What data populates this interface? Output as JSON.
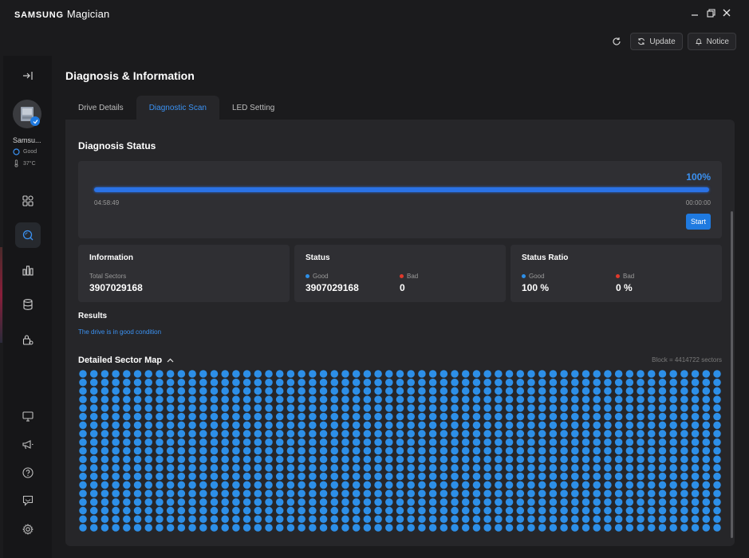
{
  "app": {
    "brand_main": "SAMSUNG",
    "brand_sub": "Magician"
  },
  "window_controls": [
    "minimize-icon",
    "restore-icon",
    "close-icon"
  ],
  "top_actions": {
    "refresh_icon": "refresh-icon",
    "update_label": "Update",
    "notice_label": "Notice"
  },
  "sidebar": {
    "drive": {
      "name": "Samsu...",
      "health": "Good",
      "temperature": "37°C"
    },
    "items": [
      {
        "name": "collapse",
        "icon": "collapse-arrow-icon"
      },
      {
        "name": "overview",
        "icon": "grid-icon"
      },
      {
        "name": "diagnosis",
        "icon": "search-icon",
        "active": true
      },
      {
        "name": "benchmark",
        "icon": "bar-chart-icon"
      },
      {
        "name": "data-management",
        "icon": "database-icon"
      },
      {
        "name": "security",
        "icon": "lock-icon"
      },
      {
        "name": "display",
        "icon": "monitor-icon"
      },
      {
        "name": "announcements",
        "icon": "megaphone-icon"
      },
      {
        "name": "help",
        "icon": "help-icon"
      },
      {
        "name": "feedback",
        "icon": "chat-icon"
      },
      {
        "name": "settings",
        "icon": "gear-icon"
      }
    ]
  },
  "page": {
    "title": "Diagnosis & Information",
    "tabs": [
      {
        "label": "Drive Details",
        "active": false
      },
      {
        "label": "Diagnostic Scan",
        "active": true
      },
      {
        "label": "LED Setting",
        "active": false
      }
    ]
  },
  "diagnosis": {
    "title": "Diagnosis Status",
    "progress_pct": 100,
    "progress_label": "100%",
    "elapsed": "04:58:49",
    "remaining": "00:00:00",
    "start_label": "Start"
  },
  "information": {
    "title": "Information",
    "total_label": "Total Sectors",
    "total_value": "3907029168"
  },
  "status": {
    "title": "Status",
    "good_label": "Good",
    "good_value": "3907029168",
    "bad_label": "Bad",
    "bad_value": "0"
  },
  "ratio": {
    "title": "Status Ratio",
    "good_label": "Good",
    "good_value": "100 %",
    "bad_label": "Bad",
    "bad_value": "0 %"
  },
  "results": {
    "title": "Results",
    "text": "The drive is in good condition"
  },
  "sector_map": {
    "title": "Detailed Sector Map",
    "legend": "Block = 4414722 sectors",
    "rows": 19,
    "cols": 59,
    "good_color": "#2d8fe8"
  },
  "colors": {
    "accent": "#3b92f3",
    "good": "#2d8fe8",
    "bad": "#e0392b"
  }
}
